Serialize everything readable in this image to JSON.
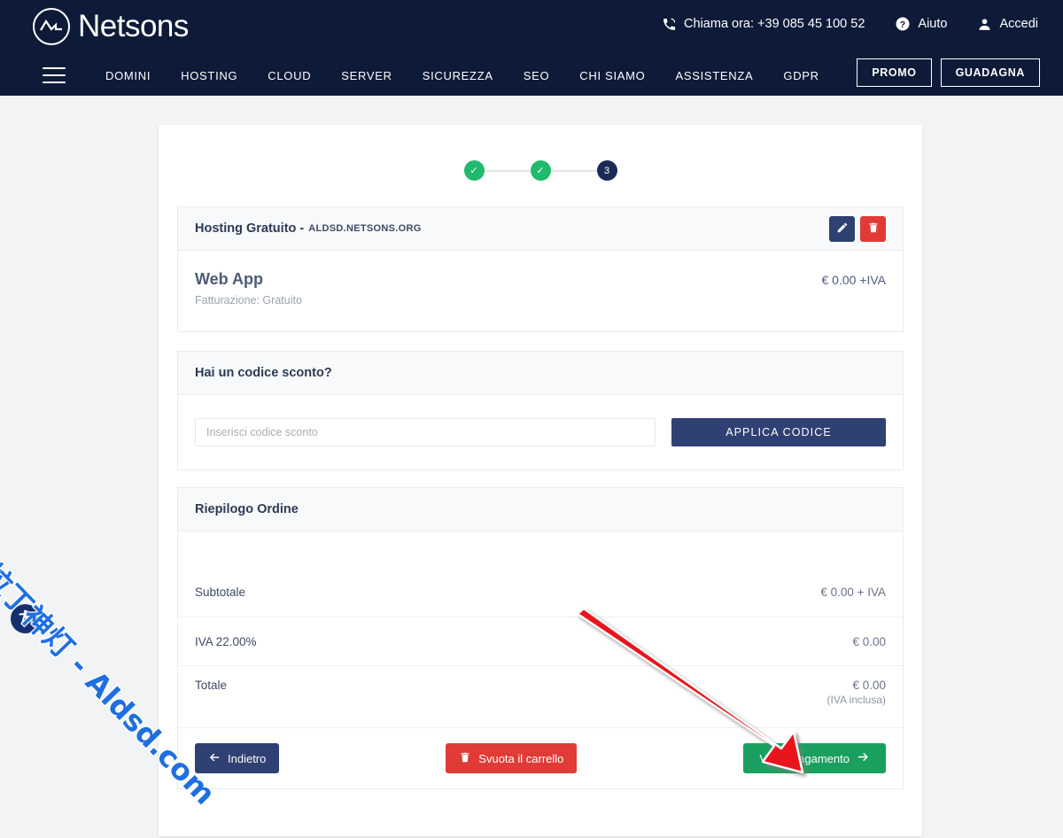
{
  "header": {
    "brand": "Netsons",
    "logo_icon": "netsons-logo-icon",
    "phone_icon": "phone-icon",
    "phone_label": "Chiama ora: +39 085 45 100 52",
    "help_icon": "question-circle-icon",
    "help_label": "Aiuto",
    "account_icon": "user-icon",
    "account_label": "Accedi",
    "menu_icon": "hamburger-menu-icon",
    "nav": [
      {
        "label": "DOMINI"
      },
      {
        "label": "HOSTING"
      },
      {
        "label": "CLOUD"
      },
      {
        "label": "SERVER"
      },
      {
        "label": "SICUREZZA"
      },
      {
        "label": "SEO"
      },
      {
        "label": "CHI SIAMO"
      },
      {
        "label": "ASSISTENZA"
      },
      {
        "label": "GDPR"
      }
    ],
    "promo_label": "PROMO",
    "earn_label": "GUADAGNA"
  },
  "steps": {
    "step1": "✓",
    "step2": "✓",
    "step3": "3"
  },
  "product_panel": {
    "title": "Hosting Gratuito -",
    "domain": "ALDSD.NETSONS.ORG",
    "edit_icon": "pencil-icon",
    "delete_icon": "trash-icon",
    "product_name": "Web App",
    "billing": "Fatturazione: Gratuito",
    "price": "€ 0.00 +IVA"
  },
  "discount_panel": {
    "title": "Hai un codice sconto?",
    "input_value": "",
    "input_placeholder": "Inserisci codice sconto",
    "apply_label": "APPLICA CODICE"
  },
  "summary_panel": {
    "title": "Riepilogo Ordine",
    "rows": [
      {
        "label": "Subtotale",
        "value": "€ 0.00 + IVA",
        "note": ""
      },
      {
        "label": "IVA 22.00%",
        "value": "€ 0.00",
        "note": ""
      },
      {
        "label": "Totale",
        "value": "€ 0.00",
        "note": "(IVA inclusa)"
      }
    ],
    "back_label": "Indietro",
    "back_icon": "arrow-left-icon",
    "empty_cart_label": "Svuota il carrello",
    "empty_cart_icon": "trash-icon",
    "pay_label": "Vai al Pagamento",
    "pay_icon": "arrow-right-icon"
  },
  "accessibility": {
    "icon": "accessibility-person-icon"
  },
  "watermark": {
    "text": "阿拉丁神灯 - Aldsd.com",
    "color": "#1f6fe0"
  },
  "annotation": {
    "arrow_color": "#e8151a",
    "target": "Vai al Pagamento"
  },
  "colors": {
    "header_bg": "#0d1b38",
    "navy": "#2f4072",
    "green": "#19a05f",
    "red": "#e03b36",
    "step_done": "#20ba6d",
    "page_bg": "#f1f3f5"
  }
}
